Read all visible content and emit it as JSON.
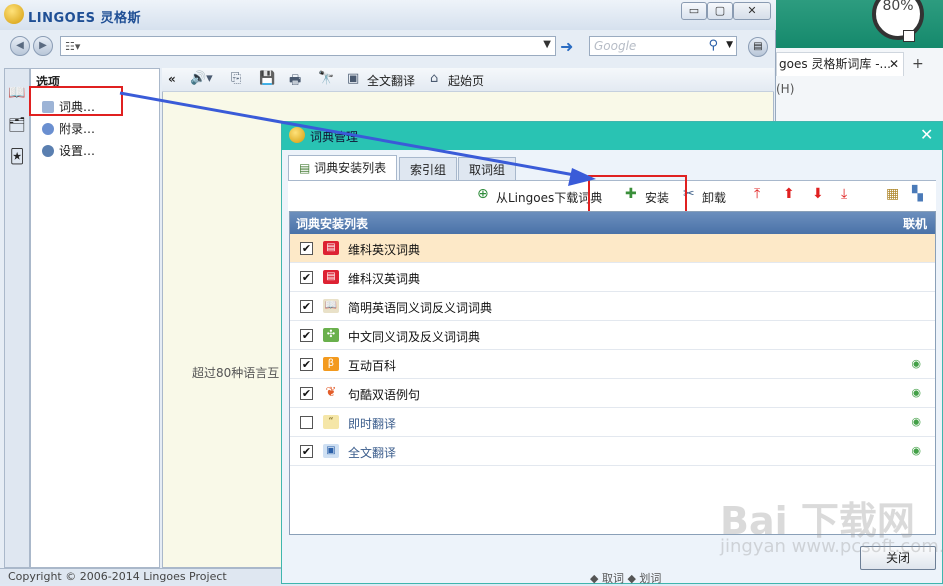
{
  "app": {
    "brand": "LINGOES 灵格斯"
  },
  "window_controls": {
    "minimize": "▭",
    "restore": "▢",
    "close": "✕"
  },
  "address_bar": {
    "value": "",
    "search_placeholder": "Google"
  },
  "options_panel": {
    "title": "选项",
    "items": [
      {
        "label": "词典…",
        "icon_color": "#7a9cc9"
      },
      {
        "label": "附录…",
        "icon_color": "#6a8fd0"
      },
      {
        "label": "设置…",
        "icon_color": "#5a7fb0"
      }
    ]
  },
  "content_toolbar": {
    "collapse": "«",
    "full_translate": "全文翻译",
    "home": "起始页"
  },
  "content": {
    "intro_text": "超过80种语言互"
  },
  "status": {
    "copyright": "Copyright © 2006-2014 Lingoes Project",
    "right_text": "◆ 取词  ◆ 划词"
  },
  "background_browser": {
    "tab_label": "goes 灵格斯词库 -...",
    "tab_close": "✕",
    "new_tab": "+",
    "menu_hint": "(H)",
    "badge": "80%"
  },
  "dialog": {
    "title": "词典管理",
    "close": "✕",
    "tabs": [
      {
        "label": "词典安装列表",
        "active": true
      },
      {
        "label": "索引组",
        "active": false
      },
      {
        "label": "取词组",
        "active": false
      }
    ],
    "toolbar": {
      "download": "从Lingoes下载词典",
      "install": "安装",
      "uninstall": "卸载"
    },
    "list_header": {
      "title": "词典安装列表",
      "online": "联机"
    },
    "rows": [
      {
        "label": "维科英汉词典",
        "checked": true,
        "selected": true,
        "online": false,
        "icon": "flag-icon",
        "dim": false
      },
      {
        "label": "维科汉英词典",
        "checked": true,
        "selected": false,
        "online": false,
        "icon": "flag-icon",
        "dim": false
      },
      {
        "label": "简明英语同义词反义词词典",
        "checked": true,
        "selected": false,
        "online": false,
        "icon": "book-icon",
        "dim": false
      },
      {
        "label": "中文同义词及反义词词典",
        "checked": true,
        "selected": false,
        "online": false,
        "icon": "puzzle-icon",
        "dim": false
      },
      {
        "label": "互动百科",
        "checked": true,
        "selected": false,
        "online": true,
        "icon": "baike-icon",
        "dim": false
      },
      {
        "label": "句酷双语例句",
        "checked": true,
        "selected": false,
        "online": true,
        "icon": "jukuu-icon",
        "dim": false
      },
      {
        "label": "即时翻译",
        "checked": false,
        "selected": false,
        "online": true,
        "icon": "quote-icon",
        "dim": true
      },
      {
        "label": "全文翻译",
        "checked": true,
        "selected": false,
        "online": true,
        "icon": "translate-icon",
        "dim": true
      }
    ],
    "close_button": "关闭"
  },
  "watermark": {
    "line1": "Bai 下载网",
    "line2": "jingyan  www.pcsoft.com.cn"
  }
}
